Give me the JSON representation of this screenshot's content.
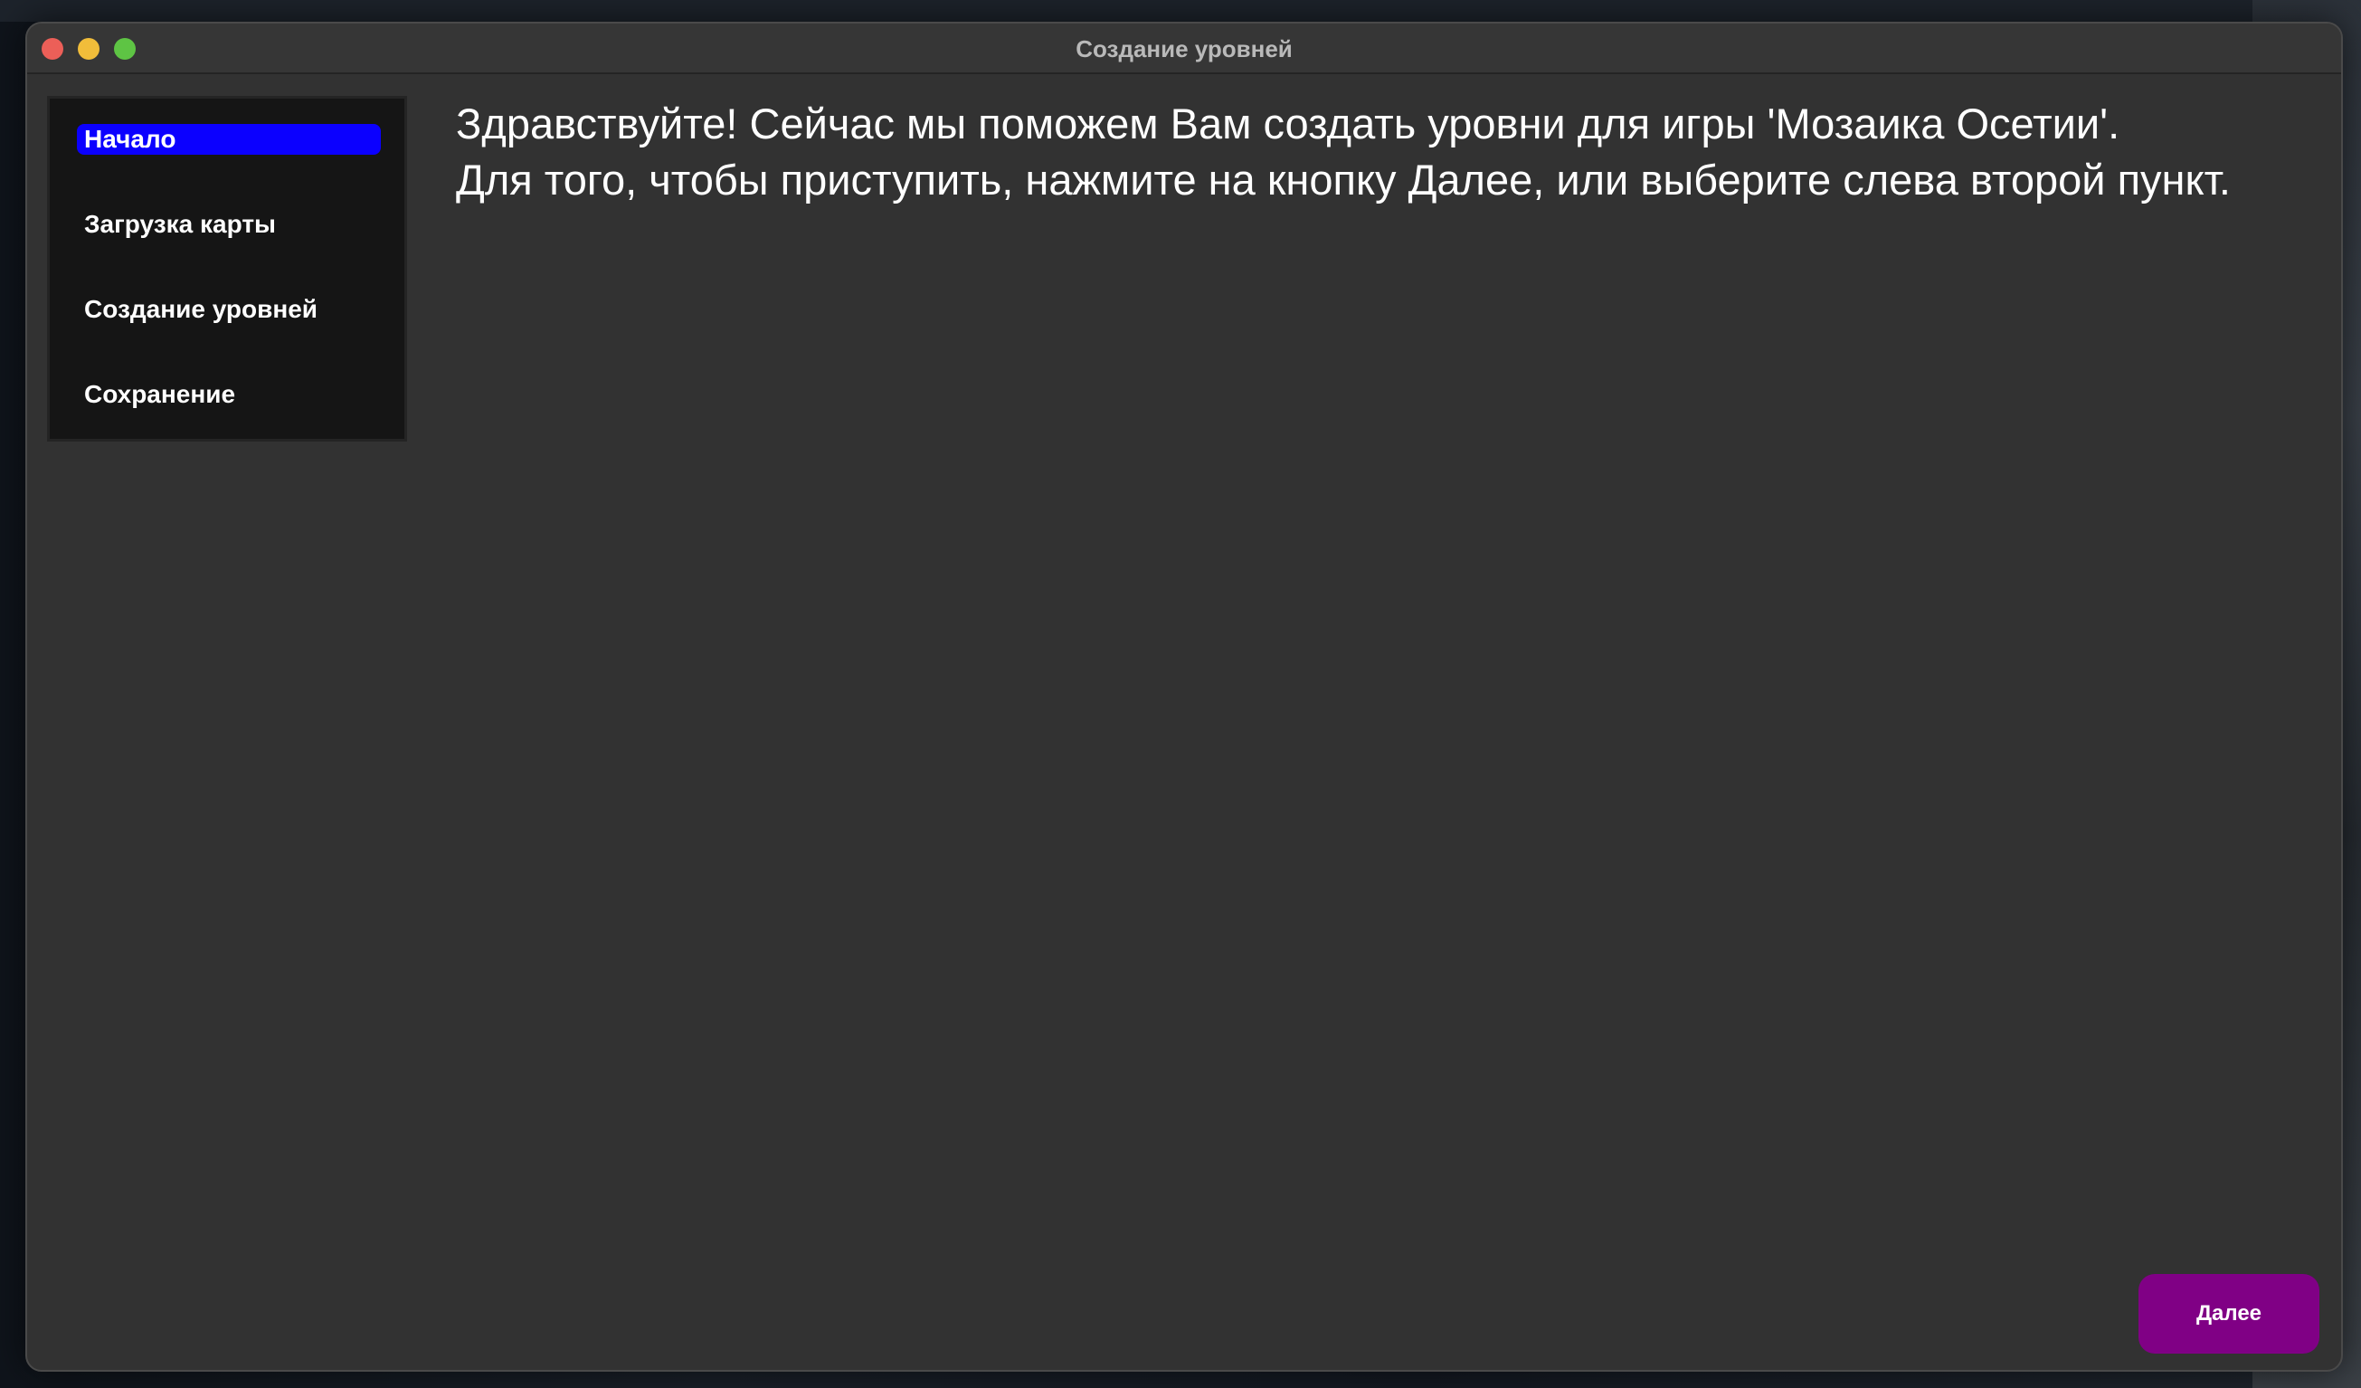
{
  "window": {
    "title": "Создание уровней"
  },
  "sidebar": {
    "items": [
      {
        "label": "Начало",
        "active": true
      },
      {
        "label": "Загрузка карты",
        "active": false
      },
      {
        "label": "Создание уровней",
        "active": false
      },
      {
        "label": "Сохранение",
        "active": false
      }
    ]
  },
  "main": {
    "line1": "Здравствуйте! Сейчас мы поможем Вам создать уровни для игры 'Мозаика Осетии'.",
    "line2": "Для того, чтобы приступить, нажмите на кнопку Далее, или выберите слева второй пункт."
  },
  "footer": {
    "next_label": "Далее"
  },
  "colors": {
    "active_item": "#0b00ff",
    "next_button": "#800085",
    "window_bg": "#323232",
    "sidebar_bg": "#151515"
  }
}
